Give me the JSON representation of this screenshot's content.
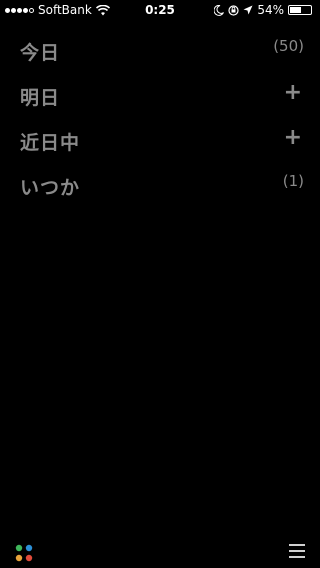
{
  "status_bar": {
    "carrier": "SoftBank",
    "time": "0:25",
    "battery_percent": "54%",
    "battery_level": 0.54,
    "signal_bars_filled": 4,
    "signal_bars_total": 5,
    "icons": [
      "wifi-icon",
      "moon-icon",
      "rotation-lock-icon",
      "location-arrow-icon",
      "battery-icon"
    ]
  },
  "list": {
    "items": [
      {
        "label": "今日",
        "count": "(50)",
        "action": null
      },
      {
        "label": "明日",
        "count": null,
        "action": "+"
      },
      {
        "label": "近日中",
        "count": null,
        "action": "+"
      },
      {
        "label": "いつか",
        "count": "(1)",
        "action": null
      }
    ]
  },
  "colors": {
    "background": "#000000",
    "text_muted": "#8a8a8a",
    "logo_dots": [
      "#3fb55a",
      "#2c8fd6",
      "#e8a33a",
      "#e04a3a"
    ]
  },
  "bottom_bar": {
    "icons": [
      "app-logo-icon",
      "menu-icon"
    ]
  }
}
